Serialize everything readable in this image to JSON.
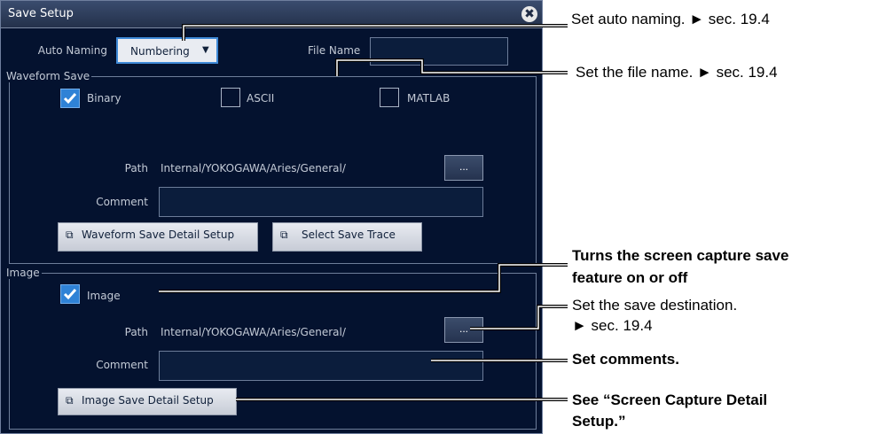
{
  "dialog": {
    "title": "Save Setup",
    "close_glyph": "✖",
    "auto_naming_label": "Auto Naming",
    "auto_naming_value": "Numbering",
    "file_name_label": "File Name",
    "file_name_value": ""
  },
  "waveform": {
    "group_label": "Waveform Save",
    "binary": {
      "label": "Binary",
      "checked": true
    },
    "ascii": {
      "label": "ASCII",
      "checked": false
    },
    "matlab": {
      "label": "MATLAB",
      "checked": false
    },
    "path_label": "Path",
    "path_value": "Internal/YOKOGAWA/Aries/General/",
    "browse_label": "...",
    "comment_label": "Comment",
    "comment_value": "",
    "detail_button": "Waveform Save Detail Setup",
    "trace_button": "Select Save Trace"
  },
  "image": {
    "group_label": "Image",
    "image_checkbox": {
      "label": "Image",
      "checked": true
    },
    "path_label": "Path",
    "path_value": "Internal/YOKOGAWA/Aries/General/",
    "browse_label": "...",
    "comment_label": "Comment",
    "comment_value": "",
    "detail_button": "Image Save Detail Setup"
  },
  "annotations": {
    "auto_naming": "Set auto naming. ► sec. 19.4",
    "file_name": "Set the file name. ► sec. 19.4",
    "capture_line1": "Turns the screen capture save",
    "capture_line2": "feature on or off",
    "dest_line1": "Set the save destination.",
    "dest_line2": "► sec. 19.4",
    "comments": "Set comments.",
    "detail_line1": "See “Screen Capture Detail",
    "detail_line2": "Setup.”"
  },
  "colors": {
    "dialog_bg": "#04122f",
    "checkbox_on": "#2f82d6",
    "select_border": "#3f8ad8"
  }
}
